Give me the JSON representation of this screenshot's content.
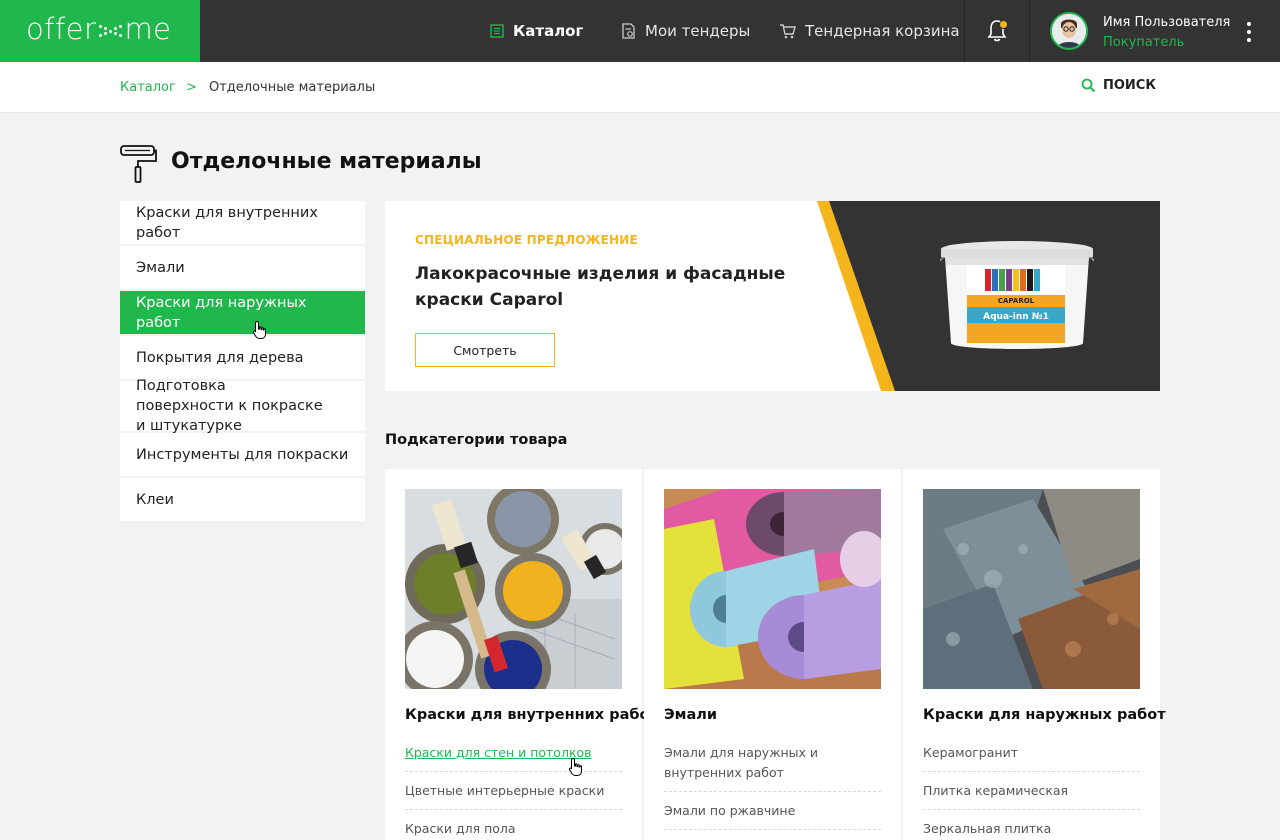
{
  "header": {
    "logo": {
      "part1": "offer",
      "part2": "me"
    },
    "nav": [
      {
        "label": "Каталог",
        "icon": "catalog-icon",
        "active": true
      },
      {
        "label": "Мои тендеры",
        "icon": "tenders-icon",
        "active": false
      },
      {
        "label": "Тендерная корзина",
        "icon": "cart-icon",
        "active": false
      }
    ],
    "notification_icon": "bell-icon",
    "user": {
      "name": "Имя Пользователя",
      "role": "Покупатель"
    },
    "colors": {
      "brand": "#20b84c",
      "topbar": "#333333",
      "accent": "#f5b51c"
    }
  },
  "breadcrumb": {
    "root": "Каталог",
    "separator": ">",
    "current": "Отделочные материалы"
  },
  "search": {
    "label": "ПОИСК"
  },
  "page": {
    "title": "Отделочные материалы",
    "icon": "paint-roller-icon"
  },
  "sidebar": {
    "items": [
      {
        "label": "Краски для внутренних работ",
        "active": false
      },
      {
        "label": "Эмали",
        "active": false
      },
      {
        "label": "Краски для наружных работ",
        "active": true
      },
      {
        "label": "Покрытия для дерева",
        "active": false
      },
      {
        "label": "Подготовка поверхности к покраске и штукатурке",
        "active": false
      },
      {
        "label": "Инструменты для покраски",
        "active": false
      },
      {
        "label": "Клеи",
        "active": false
      }
    ]
  },
  "banner": {
    "eyebrow": "СПЕЦИАЛЬНОЕ ПРЕДЛОЖЕНИЕ",
    "title": "Лакокрасочные изделия и фасадные краски Caparol",
    "button": "Смотреть",
    "product": {
      "brand": "CAPAROL",
      "name": "Aqua-inn №1"
    }
  },
  "subcategories": {
    "heading": "Подкатегории товара",
    "cards": [
      {
        "title": "Краски для внутренних работ",
        "image": "paint-cans-photo",
        "links": [
          "Краски для стен и потолков",
          "Цветные интерьерные краски",
          "Краски для пола"
        ]
      },
      {
        "title": "Эмали",
        "image": "wallpaper-rolls-photo",
        "links": [
          "Эмали для наружных и внутренних работ",
          "Эмали по ржавчине",
          ""
        ]
      },
      {
        "title": "Краски для наружных работ",
        "image": "tiles-photo",
        "links": [
          "Керамогранит",
          "Плитка керамическая",
          "Зеркальная плитка"
        ]
      }
    ]
  }
}
